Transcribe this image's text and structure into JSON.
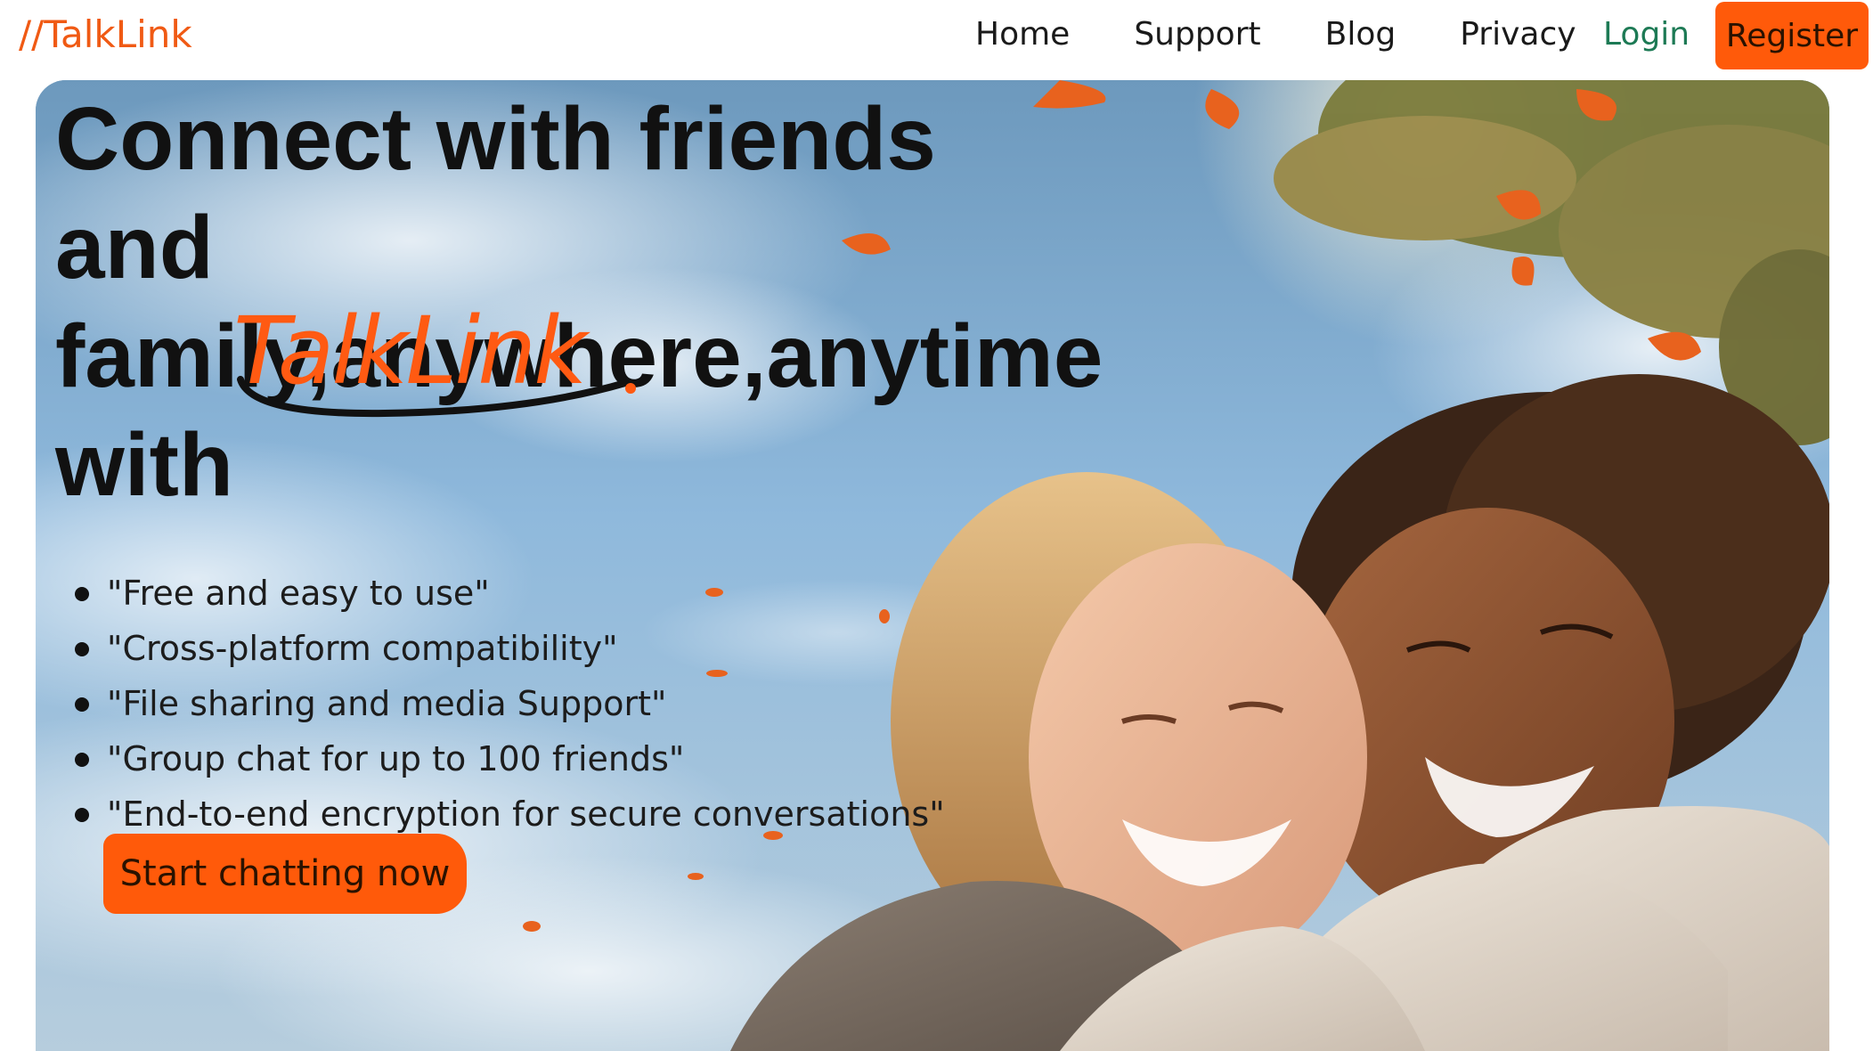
{
  "nav": {
    "brand": "//TalkLink",
    "links": [
      "Home",
      "Support",
      "Blog",
      "Privacy"
    ],
    "login": "Login",
    "register": "Register"
  },
  "hero": {
    "headline_line1": "Connect with friends and",
    "headline_line2": "family,anywhere,anytime",
    "headline_line3": "with",
    "brand_script": "TalkLink",
    "features": [
      "\"Free and easy to use\"",
      "\"Cross-platform compatibility\"",
      "\"File sharing and media Support\"",
      "\"Group chat for up to 100 friends\"",
      "\"End-to-end encryption for secure conversations\""
    ],
    "cta": "Start chatting now"
  },
  "colors": {
    "accent": "#ff5a0a",
    "brand_text": "#f05a14",
    "login_text": "#1d7a55"
  }
}
